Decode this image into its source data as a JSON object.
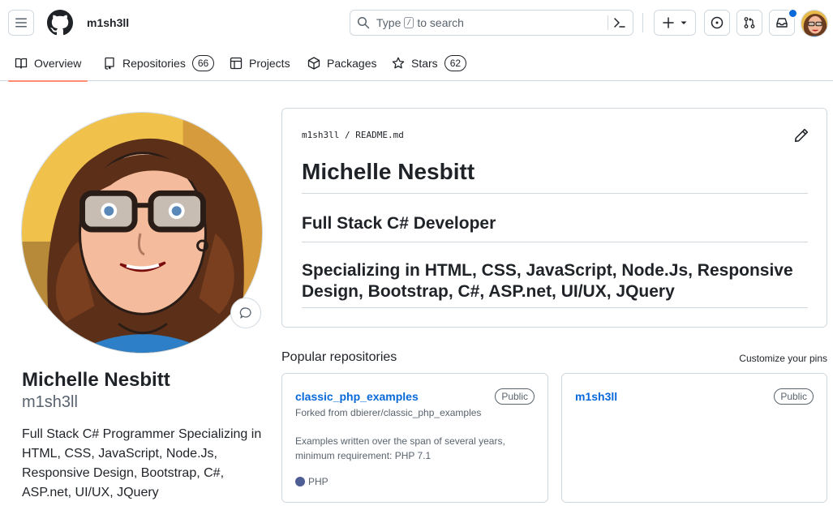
{
  "header": {
    "username": "m1sh3ll",
    "search_placeholder_pre": "Type",
    "search_key": "/",
    "search_placeholder_post": "to search"
  },
  "tabs": [
    {
      "label": "Overview",
      "icon": "book-icon",
      "active": true
    },
    {
      "label": "Repositories",
      "icon": "repo-icon",
      "count": "66"
    },
    {
      "label": "Projects",
      "icon": "table-icon"
    },
    {
      "label": "Packages",
      "icon": "package-icon"
    },
    {
      "label": "Stars",
      "icon": "star-icon",
      "count": "62"
    }
  ],
  "profile": {
    "name": "Michelle Nesbitt",
    "login": "m1sh3ll",
    "bio": "Full Stack C# Programmer Specializing in HTML, CSS, JavaScript, Node.Js, Responsive Design, Bootstrap, C#, ASP.net, UI/UX, JQuery"
  },
  "readme": {
    "path_owner": "m1sh3ll",
    "path_sep": "/",
    "path_file": "README.md",
    "h1": "Michelle Nesbitt",
    "h2a": "Full Stack C# Developer",
    "h2b": "Specializing in HTML, CSS, JavaScript, Node.Js, Responsive Design, Bootstrap, C#, ASP.net, UI/UX, JQuery"
  },
  "popular": {
    "title": "Popular repositories",
    "customize": "Customize your pins",
    "repos": [
      {
        "name": "classic_php_examples",
        "visibility": "Public",
        "fork": "Forked from dbierer/classic_php_examples",
        "description": "Examples written over the span of several years, minimum requirement: PHP 7.1",
        "language": "PHP",
        "language_color": "#4F5D95"
      },
      {
        "name": "m1sh3ll",
        "visibility": "Public"
      }
    ]
  },
  "colors": {
    "accent": "#0969da",
    "tab_underline": "#fd8c73",
    "border": "#d1d9e0",
    "muted": "#59636e"
  }
}
